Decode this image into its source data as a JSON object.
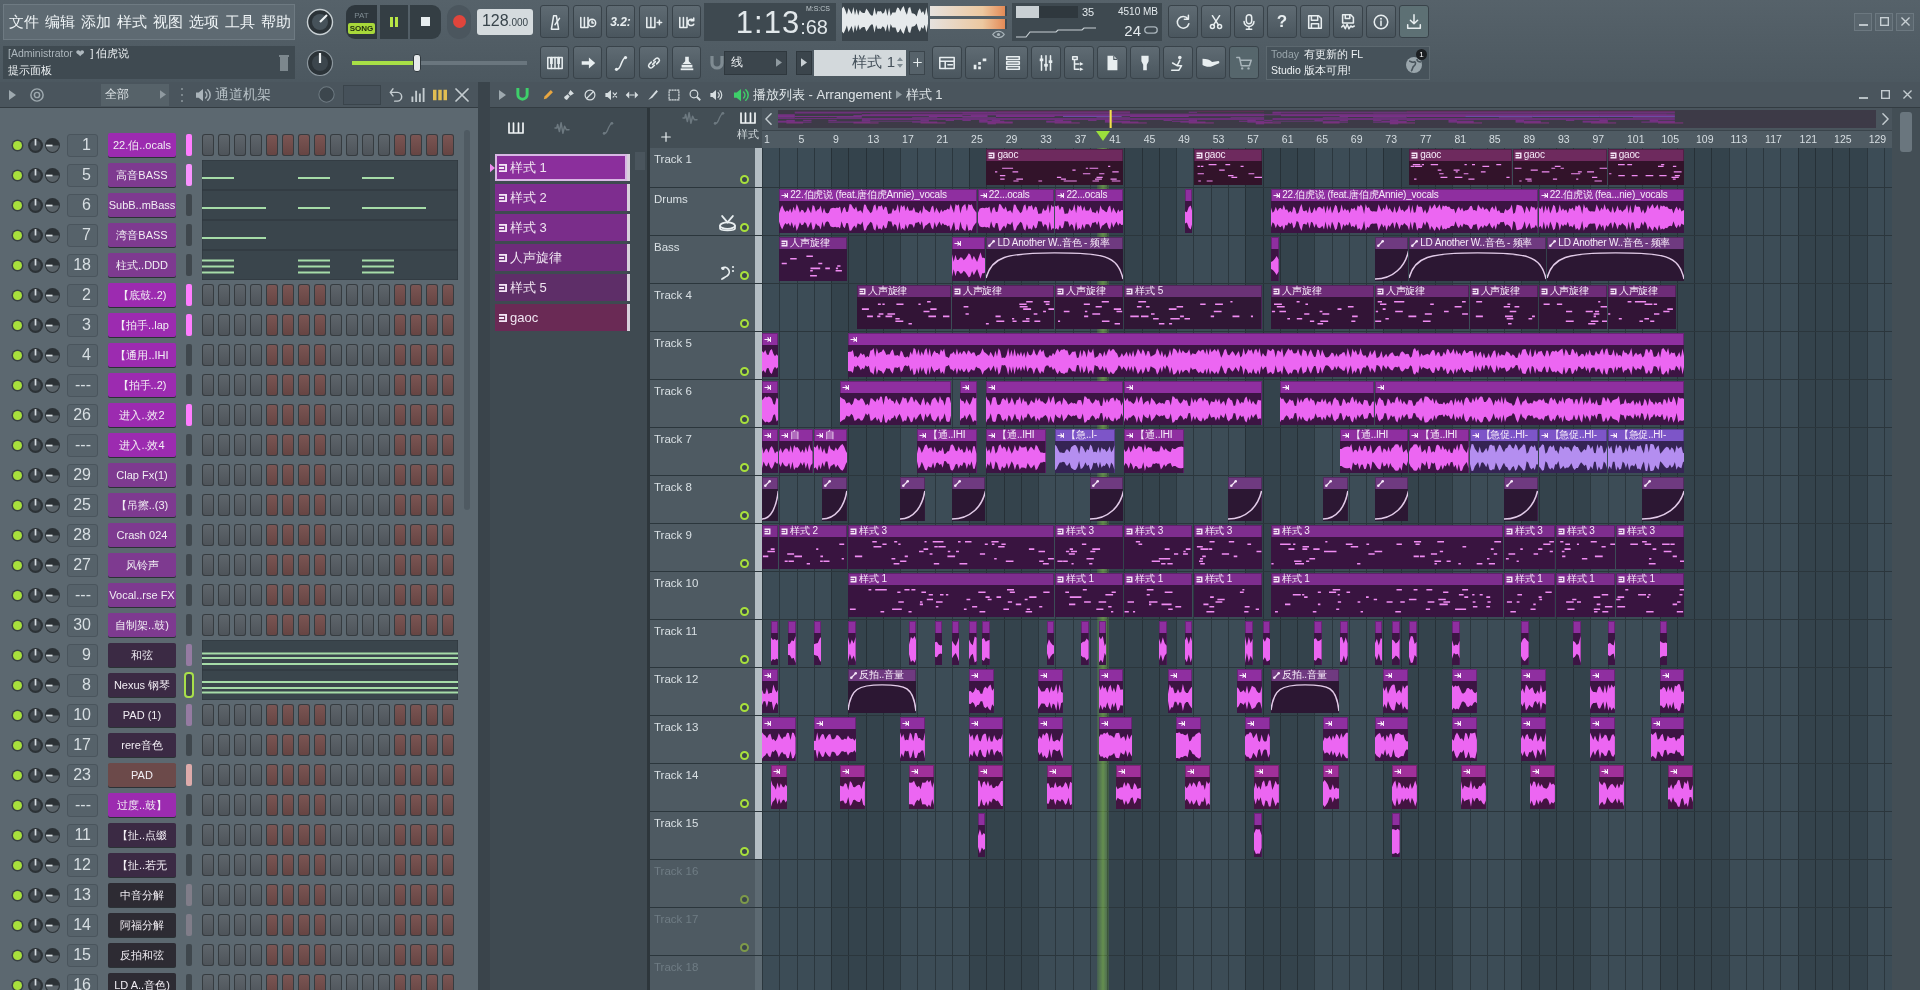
{
  "menu": [
    "文件",
    "编辑",
    "添加",
    "样式",
    "视图",
    "选项",
    "工具",
    "帮助"
  ],
  "hint_panel": {
    "user": "[Administrator ❤",
    "song": "] 伯虎说",
    "title": "提示面板"
  },
  "transport": {
    "modes": [
      {
        "label": "PAT",
        "selected": false
      },
      {
        "label": "SONG",
        "selected": true
      }
    ],
    "playing": true,
    "tempo": "128",
    "tempo_fraction": ".000",
    "countdown": "3.2:"
  },
  "time": {
    "value": "1:13",
    "fraction": ":68",
    "format": "M:S:CS"
  },
  "output_meter": [
    {
      "level": 0.97
    },
    {
      "level": 0.97
    }
  ],
  "system": {
    "cpu": {
      "reading": "35",
      "level": 0.37
    },
    "memory": "4510 MB",
    "polyphony": "24"
  },
  "help": "?",
  "master_slider": {
    "level": 0.37
  },
  "snap": "线",
  "pattern_selector": "样式 1",
  "news": {
    "label": "Today",
    "lines": [
      "有更新的 FL",
      "Studio 版本可用!"
    ],
    "badge": "1"
  },
  "channel_rack": {
    "filter": "全部",
    "title": "通道机架",
    "channels": [
      {
        "number": "1",
        "name": "22.伯..ocals",
        "color": "#9c2bb0",
        "selected": true,
        "focused": false,
        "kind": "steps"
      },
      {
        "number": "5",
        "name": "高音BASS",
        "color": "#7e3a90",
        "selected": true,
        "focused": false,
        "kind": "piano"
      },
      {
        "number": "6",
        "name": "SubB..mBass",
        "color": "#7e3a90",
        "selected": false,
        "focused": false,
        "kind": "piano"
      },
      {
        "number": "7",
        "name": "湾音BASS",
        "color": "#7e3a90",
        "selected": false,
        "focused": false,
        "kind": "piano"
      },
      {
        "number": "18",
        "name": "柱式..DDD",
        "color": "#7e3a90",
        "selected": false,
        "focused": false,
        "kind": "piano"
      },
      {
        "number": "2",
        "name": "【底鼓..2)",
        "color": "#9c2bb0",
        "selected": true,
        "focused": false,
        "kind": "steps"
      },
      {
        "number": "3",
        "name": "【拍手..lap",
        "color": "#9c2bb0",
        "selected": true,
        "focused": false,
        "kind": "steps"
      },
      {
        "number": "4",
        "name": "【通用..IHI",
        "color": "#9c2bb0",
        "selected": false,
        "focused": false,
        "kind": "steps"
      },
      {
        "number": "---",
        "name": "【拍手..2)",
        "color": "#9c2bb0",
        "selected": false,
        "focused": false,
        "kind": "steps"
      },
      {
        "number": "26",
        "name": "进入..效2",
        "color": "#9c2bb0",
        "selected": true,
        "focused": false,
        "kind": "steps"
      },
      {
        "number": "---",
        "name": "进入..效4",
        "color": "#9c2bb0",
        "selected": false,
        "focused": false,
        "kind": "steps"
      },
      {
        "number": "29",
        "name": "Clap Fx(1)",
        "color": "#7e3a90",
        "selected": false,
        "focused": false,
        "kind": "steps"
      },
      {
        "number": "25",
        "name": "【吊擦..(3)",
        "color": "#7e3a90",
        "selected": false,
        "focused": false,
        "kind": "steps"
      },
      {
        "number": "28",
        "name": "Crash 024",
        "color": "#7e3a90",
        "selected": false,
        "focused": false,
        "kind": "steps"
      },
      {
        "number": "27",
        "name": "风铃声",
        "color": "#7e3a90",
        "selected": false,
        "focused": false,
        "kind": "steps"
      },
      {
        "number": "---",
        "name": "Vocal..rse FX",
        "color": "#7e3a90",
        "selected": false,
        "focused": false,
        "kind": "steps"
      },
      {
        "number": "30",
        "name": "自制架..鼓)",
        "color": "#7e3a90",
        "selected": false,
        "focused": false,
        "kind": "steps"
      },
      {
        "number": "9",
        "name": "和弦",
        "color": "#3b2a44",
        "selected": true,
        "focused": false,
        "kind": "piano"
      },
      {
        "number": "8",
        "name": "Nexus 钢琴",
        "color": "#3b2a44",
        "selected": false,
        "focused": true,
        "kind": "piano"
      },
      {
        "number": "10",
        "name": "PAD (1)",
        "color": "#3b2a44",
        "selected": true,
        "focused": false,
        "kind": "steps"
      },
      {
        "number": "17",
        "name": "rere音色",
        "color": "#3b2a44",
        "selected": false,
        "focused": false,
        "kind": "steps"
      },
      {
        "number": "23",
        "name": "PAD",
        "color": "#6c4a4a",
        "selected": true,
        "focused": false,
        "kind": "steps"
      },
      {
        "number": "---",
        "name": "过度..鼓】",
        "color": "#9c2bb0",
        "selected": false,
        "focused": false,
        "kind": "steps"
      },
      {
        "number": "11",
        "name": "【扯..点缀",
        "color": "#3b2a44",
        "selected": false,
        "focused": false,
        "kind": "steps"
      },
      {
        "number": "12",
        "name": "【扯..若无",
        "color": "#3b2a44",
        "selected": false,
        "focused": false,
        "kind": "steps"
      },
      {
        "number": "13",
        "name": "中音分解",
        "color": "#2d2b33",
        "selected": true,
        "focused": false,
        "kind": "steps"
      },
      {
        "number": "14",
        "name": "阿福分解",
        "color": "#2d2b33",
        "selected": true,
        "focused": false,
        "kind": "steps"
      },
      {
        "number": "15",
        "name": "反拍和弦",
        "color": "#2d2b33",
        "selected": false,
        "focused": false,
        "kind": "steps"
      },
      {
        "number": "16",
        "name": "LD A..音色)",
        "color": "#2d2b33",
        "selected": false,
        "focused": false,
        "kind": "steps"
      }
    ]
  },
  "playlist": {
    "title": "播放列表 - Arrangement",
    "pattern": "样式 1",
    "filter_label": "样式",
    "patterns": [
      {
        "label": "样式 1",
        "selected": true,
        "color": "#8b2f9c"
      },
      {
        "label": "样式 2",
        "selected": false,
        "color": "#7e2d8f"
      },
      {
        "label": "样式 3",
        "selected": false,
        "color": "#7a2d8a"
      },
      {
        "label": "人声旋律",
        "selected": false,
        "color": "#6d2c7a"
      },
      {
        "label": "样式 5",
        "selected": false,
        "color": "#5e2e68"
      },
      {
        "label": "gaoc",
        "selected": false,
        "color": "#6a2a55"
      }
    ],
    "bars": [
      "1",
      "5",
      "9",
      "13",
      "17",
      "21",
      "25",
      "29",
      "33",
      "37",
      "41",
      "45",
      "49",
      "53",
      "57",
      "61",
      "65",
      "69",
      "73",
      "77",
      "81",
      "85",
      "89",
      "93",
      "97",
      "101",
      "105",
      "109",
      "113",
      "117",
      "121",
      "125",
      "129"
    ],
    "playhead": {
      "level": 0.302
    },
    "tracks": [
      {
        "name": "Track 1",
        "kind": "plain",
        "active": true,
        "clips": [
          {
            "kind": "pattern",
            "label": "gaoc",
            "color": "#6e2a5e"
          },
          {
            "kind": "pattern",
            "label": "gaoc",
            "color": "#6e2a5e"
          },
          {
            "kind": "pattern",
            "label": "gaoc",
            "color": "#6e2a5e"
          },
          {
            "kind": "pattern",
            "label": "gaoc",
            "color": "#6e2a5e"
          },
          {
            "kind": "pattern",
            "label": "gaoc",
            "color": "#6e2a5e"
          }
        ]
      },
      {
        "name": "Drums",
        "kind": "drums",
        "active": true,
        "clips": [
          {
            "kind": "audio",
            "label": "22.伯虎说 (feat.唐伯虎Annie)_vocals",
            "color": "#8f2fa0"
          },
          {
            "kind": "audio",
            "label": "22...ocals",
            "color": "#8f2fa0"
          },
          {
            "kind": "audio",
            "label": "22...ocals",
            "color": "#8f2fa0"
          },
          {
            "kind": "audio",
            "color": "#8f2fa0"
          },
          {
            "kind": "audio",
            "label": "22.伯虎说 (feat.唐伯虎Annie)_vocals",
            "color": "#8f2fa0"
          },
          {
            "kind": "audio",
            "label": "22.伯虎说 (fea...nie)_vocals",
            "color": "#8f2fa0"
          }
        ]
      },
      {
        "name": "Bass",
        "kind": "bass",
        "active": true,
        "clips": [
          {
            "kind": "pattern",
            "label": "人声旋律",
            "color": "#7a2f8a"
          },
          {
            "kind": "audio",
            "color": "#8f2fa0"
          },
          {
            "kind": "automation",
            "label": "LD Another W..音色 - 频率",
            "color": "#6f3a80"
          },
          {
            "kind": "audio",
            "color": "#8f2fa0"
          },
          {
            "kind": "automation",
            "color": "#6f3a80"
          },
          {
            "kind": "automation",
            "label": "LD Another W..音色 - 频率",
            "color": "#6f3a80"
          },
          {
            "kind": "automation",
            "label": "LD Another W..音色 - 频率",
            "color": "#6f3a80"
          }
        ]
      },
      {
        "name": "Track 4",
        "kind": "plain",
        "active": true,
        "clips": [
          {
            "kind": "pattern",
            "label": "人声旋律",
            "color": "#6e2c78"
          },
          {
            "kind": "pattern",
            "label": "人声旋律",
            "color": "#6e2c78"
          },
          {
            "kind": "pattern",
            "label": "人声旋律",
            "color": "#6e2c78"
          },
          {
            "kind": "pattern",
            "label": "样式 5",
            "color": "#6a3276"
          },
          {
            "kind": "pattern",
            "label": "人声旋律",
            "color": "#6e2c78"
          },
          {
            "kind": "pattern",
            "label": "人声旋律",
            "color": "#6e2c78"
          },
          {
            "kind": "pattern",
            "label": "人声旋律",
            "color": "#6e2c78"
          },
          {
            "kind": "pattern",
            "label": "人声旋律",
            "color": "#6e2c78"
          },
          {
            "kind": "pattern",
            "label": "人声旋律",
            "color": "#6e2c78"
          }
        ]
      },
      {
        "name": "Track 5",
        "kind": "plain",
        "active": true,
        "clips": [
          {
            "kind": "audio",
            "color": "#8f2fa0"
          },
          {
            "kind": "audio",
            "color": "#8f2fa0"
          }
        ]
      },
      {
        "name": "Track 6",
        "kind": "plain",
        "active": true,
        "clips": [
          {
            "kind": "audio",
            "color": "#8f2fa0"
          },
          {
            "kind": "audio",
            "color": "#8f2fa0"
          },
          {
            "kind": "audio",
            "color": "#8f2fa0"
          },
          {
            "kind": "audio",
            "color": "#8f2fa0"
          },
          {
            "kind": "audio",
            "color": "#8f2fa0"
          },
          {
            "kind": "audio",
            "color": "#8f2fa0"
          },
          {
            "kind": "audio",
            "color": "#8f2fa0"
          }
        ]
      },
      {
        "name": "Track 7",
        "kind": "plain",
        "active": true,
        "clips": [
          {
            "kind": "audio",
            "color": "#8f2fa0"
          },
          {
            "kind": "audio",
            "label": "自",
            "color": "#8f2fa0"
          },
          {
            "kind": "audio",
            "label": "自",
            "color": "#8f2fa0"
          },
          {
            "kind": "audio",
            "label": "【通..IHI",
            "color": "#8f2fa0"
          },
          {
            "kind": "audio",
            "label": "【通..IHI",
            "color": "#8f2fa0"
          },
          {
            "kind": "audio",
            "label": "【急..I-",
            "color": "#7d55c8"
          },
          {
            "kind": "audio",
            "label": "【通..IHI",
            "color": "#8f2fa0"
          },
          {
            "kind": "audio",
            "label": "【通..IHI",
            "color": "#8f2fa0"
          },
          {
            "kind": "audio",
            "label": "【通..IHI",
            "color": "#8f2fa0"
          },
          {
            "kind": "audio",
            "label": "【急促..HI-",
            "color": "#7d55c8"
          },
          {
            "kind": "audio",
            "label": "【急促..HI-",
            "color": "#7d55c8"
          },
          {
            "kind": "audio",
            "label": "【急促..HI-",
            "color": "#7d55c8"
          }
        ]
      },
      {
        "name": "Track 8",
        "kind": "plain",
        "active": true,
        "clips": [
          {
            "kind": "automation",
            "color": "#6f3a80"
          },
          {
            "kind": "automation",
            "color": "#6f3a80"
          },
          {
            "kind": "automation",
            "color": "#6f3a80"
          },
          {
            "kind": "automation",
            "color": "#6f3a80"
          },
          {
            "kind": "automation",
            "color": "#6f3a80"
          },
          {
            "kind": "automation",
            "color": "#6f3a80"
          },
          {
            "kind": "automation",
            "color": "#6f3a80"
          },
          {
            "kind": "automation",
            "color": "#6f3a80"
          },
          {
            "kind": "automation",
            "color": "#6f3a80"
          },
          {
            "kind": "automation",
            "color": "#6f3a80"
          }
        ]
      },
      {
        "name": "Track 9",
        "kind": "plain",
        "active": true,
        "clips": [
          {
            "kind": "pattern",
            "color": "#7e2d8e"
          },
          {
            "kind": "pattern",
            "label": "样式 2",
            "color": "#7e2d8e"
          },
          {
            "kind": "pattern",
            "label": "样式 3",
            "color": "#7e2d8e"
          },
          {
            "kind": "pattern",
            "label": "样式 3",
            "color": "#7e2d8e"
          },
          {
            "kind": "pattern",
            "label": "样式 3",
            "color": "#7e2d8e"
          },
          {
            "kind": "pattern",
            "label": "样式 3",
            "color": "#7e2d8e"
          },
          {
            "kind": "pattern",
            "label": "样式 3",
            "color": "#7e2d8e"
          },
          {
            "kind": "pattern",
            "label": "样式 3",
            "color": "#7e2d8e"
          },
          {
            "kind": "pattern",
            "label": "样式 3",
            "color": "#7e2d8e"
          },
          {
            "kind": "pattern",
            "label": "样式 3",
            "color": "#7e2d8e"
          }
        ]
      },
      {
        "name": "Track 10",
        "kind": "plain",
        "active": true,
        "clips": [
          {
            "kind": "pattern",
            "label": "样式 1",
            "color": "#7e2d8e"
          },
          {
            "kind": "pattern",
            "label": "样式 1",
            "color": "#7e2d8e"
          },
          {
            "kind": "pattern",
            "label": "样式 1",
            "color": "#7e2d8e"
          },
          {
            "kind": "pattern",
            "label": "样式 1",
            "color": "#7e2d8e"
          },
          {
            "kind": "pattern",
            "label": "样式 1",
            "color": "#7e2d8e"
          },
          {
            "kind": "pattern",
            "label": "样式 1",
            "color": "#7e2d8e"
          },
          {
            "kind": "pattern",
            "label": "样式 1",
            "color": "#7e2d8e"
          },
          {
            "kind": "pattern",
            "label": "样式 1",
            "color": "#7e2d8e"
          }
        ]
      },
      {
        "name": "Track 11",
        "kind": "plain",
        "active": true,
        "clips": [
          {
            "kind": "audio",
            "color": "#8f2fa0"
          },
          {
            "kind": "audio",
            "color": "#8f2fa0"
          },
          {
            "kind": "audio",
            "color": "#8f2fa0"
          },
          {
            "kind": "audio",
            "color": "#8f2fa0"
          },
          {
            "kind": "audio",
            "color": "#8f2fa0"
          },
          {
            "kind": "audio",
            "color": "#8f2fa0"
          },
          {
            "kind": "audio",
            "color": "#8f2fa0"
          },
          {
            "kind": "audio",
            "color": "#8f2fa0"
          },
          {
            "kind": "audio",
            "color": "#8f2fa0"
          },
          {
            "kind": "audio",
            "color": "#8f2fa0"
          },
          {
            "kind": "audio",
            "color": "#8f2fa0"
          },
          {
            "kind": "audio",
            "color": "#8f2fa0"
          },
          {
            "kind": "audio",
            "color": "#8f2fa0"
          },
          {
            "kind": "audio",
            "color": "#8f2fa0"
          },
          {
            "kind": "audio",
            "color": "#8f2fa0"
          },
          {
            "kind": "audio",
            "color": "#8f2fa0"
          },
          {
            "kind": "audio",
            "color": "#8f2fa0"
          },
          {
            "kind": "audio",
            "color": "#8f2fa0"
          },
          {
            "kind": "audio",
            "color": "#8f2fa0"
          },
          {
            "kind": "audio",
            "color": "#8f2fa0"
          },
          {
            "kind": "audio",
            "color": "#8f2fa0"
          },
          {
            "kind": "audio",
            "color": "#8f2fa0"
          },
          {
            "kind": "audio",
            "color": "#8f2fa0"
          },
          {
            "kind": "audio",
            "color": "#8f2fa0"
          },
          {
            "kind": "audio",
            "color": "#8f2fa0"
          },
          {
            "kind": "audio",
            "color": "#8f2fa0"
          }
        ]
      },
      {
        "name": "Track 12",
        "kind": "plain",
        "active": true,
        "clips": [
          {
            "kind": "audio",
            "color": "#8f2fa0"
          },
          {
            "kind": "automation",
            "label": "反拍..音量",
            "color": "#6f3a80"
          },
          {
            "kind": "audio",
            "color": "#8f2fa0"
          },
          {
            "kind": "audio",
            "color": "#8f2fa0"
          },
          {
            "kind": "audio",
            "color": "#8f2fa0"
          },
          {
            "kind": "audio",
            "color": "#8f2fa0"
          },
          {
            "kind": "audio",
            "color": "#8f2fa0"
          },
          {
            "kind": "automation",
            "label": "反拍..音量",
            "color": "#6f3a80"
          },
          {
            "kind": "audio",
            "color": "#8f2fa0"
          },
          {
            "kind": "audio",
            "color": "#8f2fa0"
          },
          {
            "kind": "audio",
            "color": "#8f2fa0"
          },
          {
            "kind": "audio",
            "color": "#8f2fa0"
          },
          {
            "kind": "audio",
            "color": "#8f2fa0"
          }
        ]
      },
      {
        "name": "Track 13",
        "kind": "plain",
        "active": true,
        "clips": [
          {
            "kind": "audio",
            "color": "#8f2fa0"
          },
          {
            "kind": "audio",
            "color": "#8f2fa0"
          },
          {
            "kind": "audio",
            "color": "#8f2fa0"
          },
          {
            "kind": "audio",
            "color": "#8f2fa0"
          },
          {
            "kind": "audio",
            "color": "#8f2fa0"
          },
          {
            "kind": "audio",
            "color": "#8f2fa0"
          },
          {
            "kind": "audio",
            "color": "#8f2fa0"
          },
          {
            "kind": "audio",
            "color": "#8f2fa0"
          },
          {
            "kind": "audio",
            "color": "#8f2fa0"
          },
          {
            "kind": "audio",
            "color": "#8f2fa0"
          },
          {
            "kind": "audio",
            "color": "#8f2fa0"
          },
          {
            "kind": "audio",
            "color": "#8f2fa0"
          },
          {
            "kind": "audio",
            "color": "#8f2fa0"
          },
          {
            "kind": "audio",
            "color": "#8f2fa0"
          }
        ]
      },
      {
        "name": "Track 14",
        "kind": "plain",
        "active": true,
        "clips": [
          {
            "kind": "audio",
            "color": "#a0309a"
          },
          {
            "kind": "audio",
            "color": "#a0309a"
          },
          {
            "kind": "audio",
            "color": "#a0309a"
          },
          {
            "kind": "audio",
            "color": "#a0309a"
          },
          {
            "kind": "audio",
            "color": "#a0309a"
          },
          {
            "kind": "audio",
            "color": "#a0309a"
          },
          {
            "kind": "audio",
            "color": "#a0309a"
          },
          {
            "kind": "audio",
            "color": "#a0309a"
          },
          {
            "kind": "audio",
            "color": "#a0309a"
          },
          {
            "kind": "audio",
            "color": "#a0309a"
          },
          {
            "kind": "audio",
            "color": "#a0309a"
          },
          {
            "kind": "audio",
            "color": "#a0309a"
          },
          {
            "kind": "audio",
            "color": "#a0309a"
          },
          {
            "kind": "audio",
            "color": "#a0309a"
          }
        ]
      },
      {
        "name": "Track 15",
        "kind": "plain",
        "active": true,
        "clips": [
          {
            "kind": "audio",
            "color": "#8f2fa0"
          },
          {
            "kind": "audio",
            "color": "#8f2fa0"
          },
          {
            "kind": "audio",
            "color": "#8f2fa0"
          }
        ]
      },
      {
        "name": "Track 16",
        "kind": "plain",
        "active": false
      },
      {
        "name": "Track 17",
        "kind": "plain",
        "active": false
      },
      {
        "name": "Track 18",
        "kind": "plain",
        "active": false
      }
    ]
  }
}
